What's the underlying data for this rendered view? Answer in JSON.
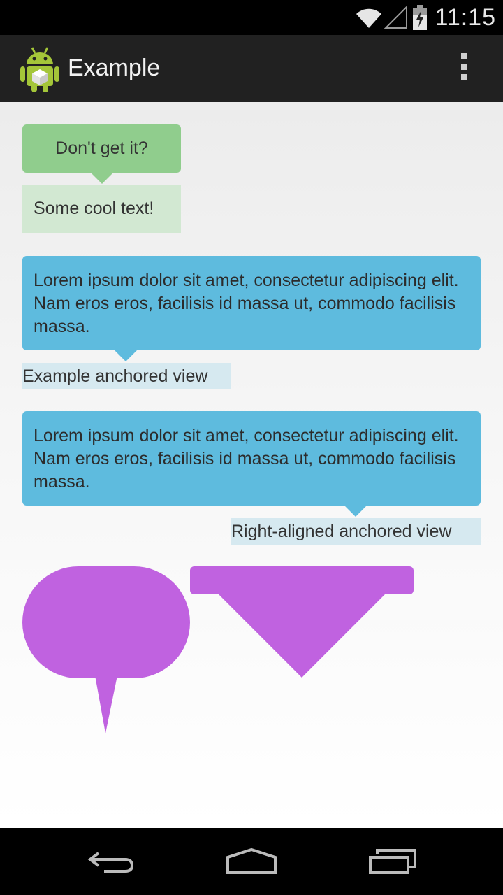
{
  "status_bar": {
    "time": "11:15",
    "icons": [
      "wifi-icon",
      "signal-icon",
      "battery-charging-icon"
    ]
  },
  "action_bar": {
    "title": "Example",
    "app_icon": "android-robot-icon",
    "overflow_icon": "overflow-menu-icon"
  },
  "tooltips": {
    "green": {
      "tip_text": "Don't get it?",
      "anchor_text": "Some cool text!",
      "tip_color": "#90cd8d",
      "anchor_color": "#d2e8d2"
    },
    "blue_left": {
      "tip_text": "Lorem ipsum dolor sit amet, consectetur adipiscing elit. Nam eros eros, facilisis id massa ut, commodo facilisis massa.",
      "anchor_text": "Example anchored view",
      "tip_color": "#5ebbde",
      "anchor_color": "#d6e9f0"
    },
    "blue_right": {
      "tip_text": "Lorem ipsum dolor sit amet, consectetur adipiscing elit. Nam eros eros, facilisis id massa ut, commodo facilisis massa.",
      "anchor_text": "Right-aligned anchored view",
      "tip_color": "#5ebbde",
      "anchor_color": "#d6e9f0"
    },
    "purple_shapes": {
      "color": "#c062e0"
    }
  },
  "nav_bar": {
    "buttons": [
      "back-icon",
      "home-icon",
      "recent-apps-icon"
    ]
  }
}
